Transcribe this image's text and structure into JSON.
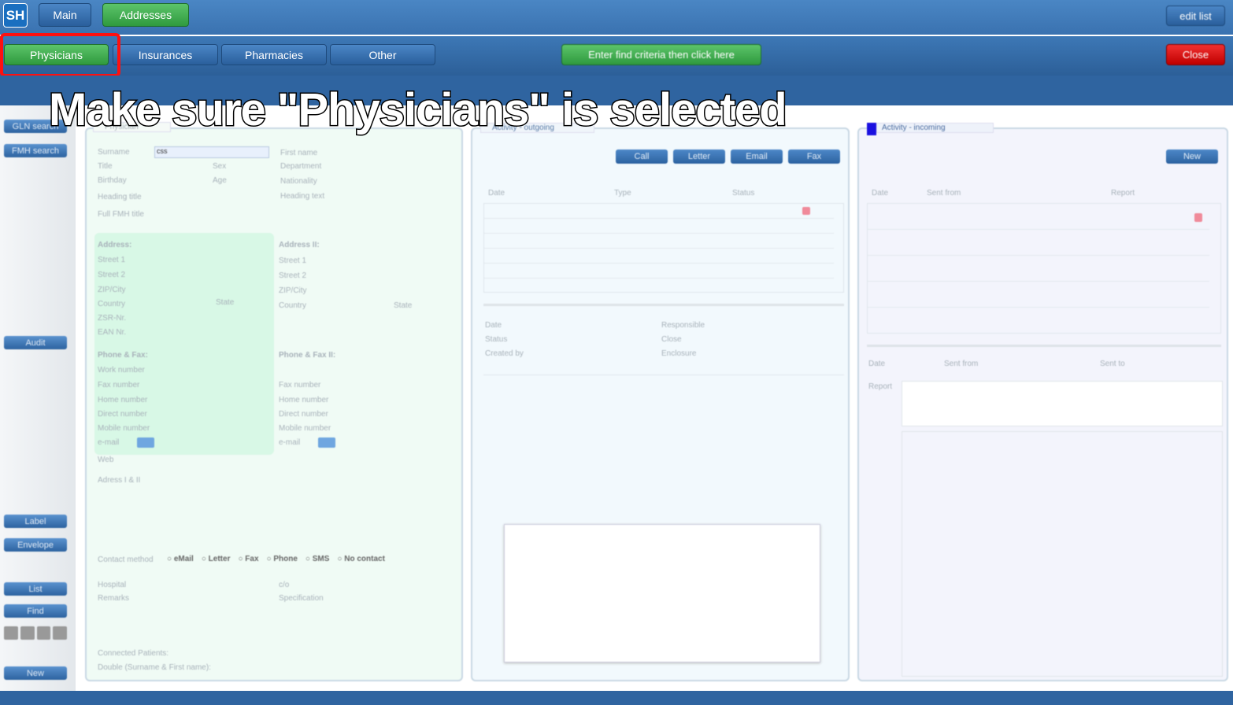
{
  "header": {
    "logo": "SH",
    "tabs": [
      "Main",
      "Addresses"
    ],
    "edit_list": "edit list"
  },
  "subtabs": [
    "Physicians",
    "Insurances",
    "Pharmacies",
    "Other"
  ],
  "find_button": "Enter find criteria then click here",
  "close_button": "Close",
  "annotation": "Make sure \"Physicians\" is selected",
  "sidebar": {
    "gln": "GLN search",
    "fmh": "FMH search",
    "audit": "Audit",
    "label": "Label",
    "envelope": "Envelope",
    "list": "List",
    "find": "Find",
    "new": "New"
  },
  "physician": {
    "tab": "Physician",
    "surname_label": "Surname",
    "surname_value": "css",
    "fields_left": [
      "Title",
      "Birthday",
      "Heading title",
      "Full FMH title"
    ],
    "sex": "Sex",
    "age": "Age",
    "fields_right": [
      "First name",
      "Department",
      "Nationality",
      "Heading text"
    ],
    "address": {
      "title": "Address:",
      "fields": [
        "Street 1",
        "Street 2",
        "ZIP/City",
        "Country",
        "ZSR-Nr.",
        "EAN Nr."
      ],
      "state": "State"
    },
    "address2": {
      "title": "Address II:",
      "fields": [
        "Street 1",
        "Street 2",
        "ZIP/City",
        "Country"
      ],
      "state": "State"
    },
    "phone": {
      "title": "Phone & Fax:",
      "fields": [
        "Work number",
        "Fax number",
        "Home number",
        "Direct number",
        "Mobile number",
        "e-mail"
      ]
    },
    "phone2": {
      "title": "Phone & Fax II:",
      "fields": [
        "Fax number",
        "Home number",
        "Direct number",
        "Mobile number",
        "e-mail"
      ]
    },
    "web": "Web",
    "address_both": "Adress I & II",
    "contact_method": "Contact method",
    "contact_options": [
      "eMail",
      "Letter",
      "Fax",
      "Phone",
      "SMS",
      "No contact"
    ],
    "hospital": "Hospital",
    "remarks": "Remarks",
    "co": "c/o",
    "specification": "Specification",
    "connected": "Connected Patients:",
    "double": "Double (Surname & First name):"
  },
  "outgoing": {
    "tab": "Activity - outgoing",
    "buttons": [
      "Call",
      "Letter",
      "Email",
      "Fax"
    ],
    "columns": [
      "Date",
      "Type",
      "Status"
    ],
    "details_left": [
      "Date",
      "Status",
      "Created by"
    ],
    "details_right": [
      "Responsible",
      "Close",
      "Enclosure"
    ]
  },
  "incoming": {
    "tab": "Activity - incoming",
    "new": "New",
    "columns": [
      "Date",
      "Sent from",
      "Report"
    ],
    "filters": [
      "Date",
      "Sent from",
      "Sent to"
    ],
    "report": "Report"
  }
}
